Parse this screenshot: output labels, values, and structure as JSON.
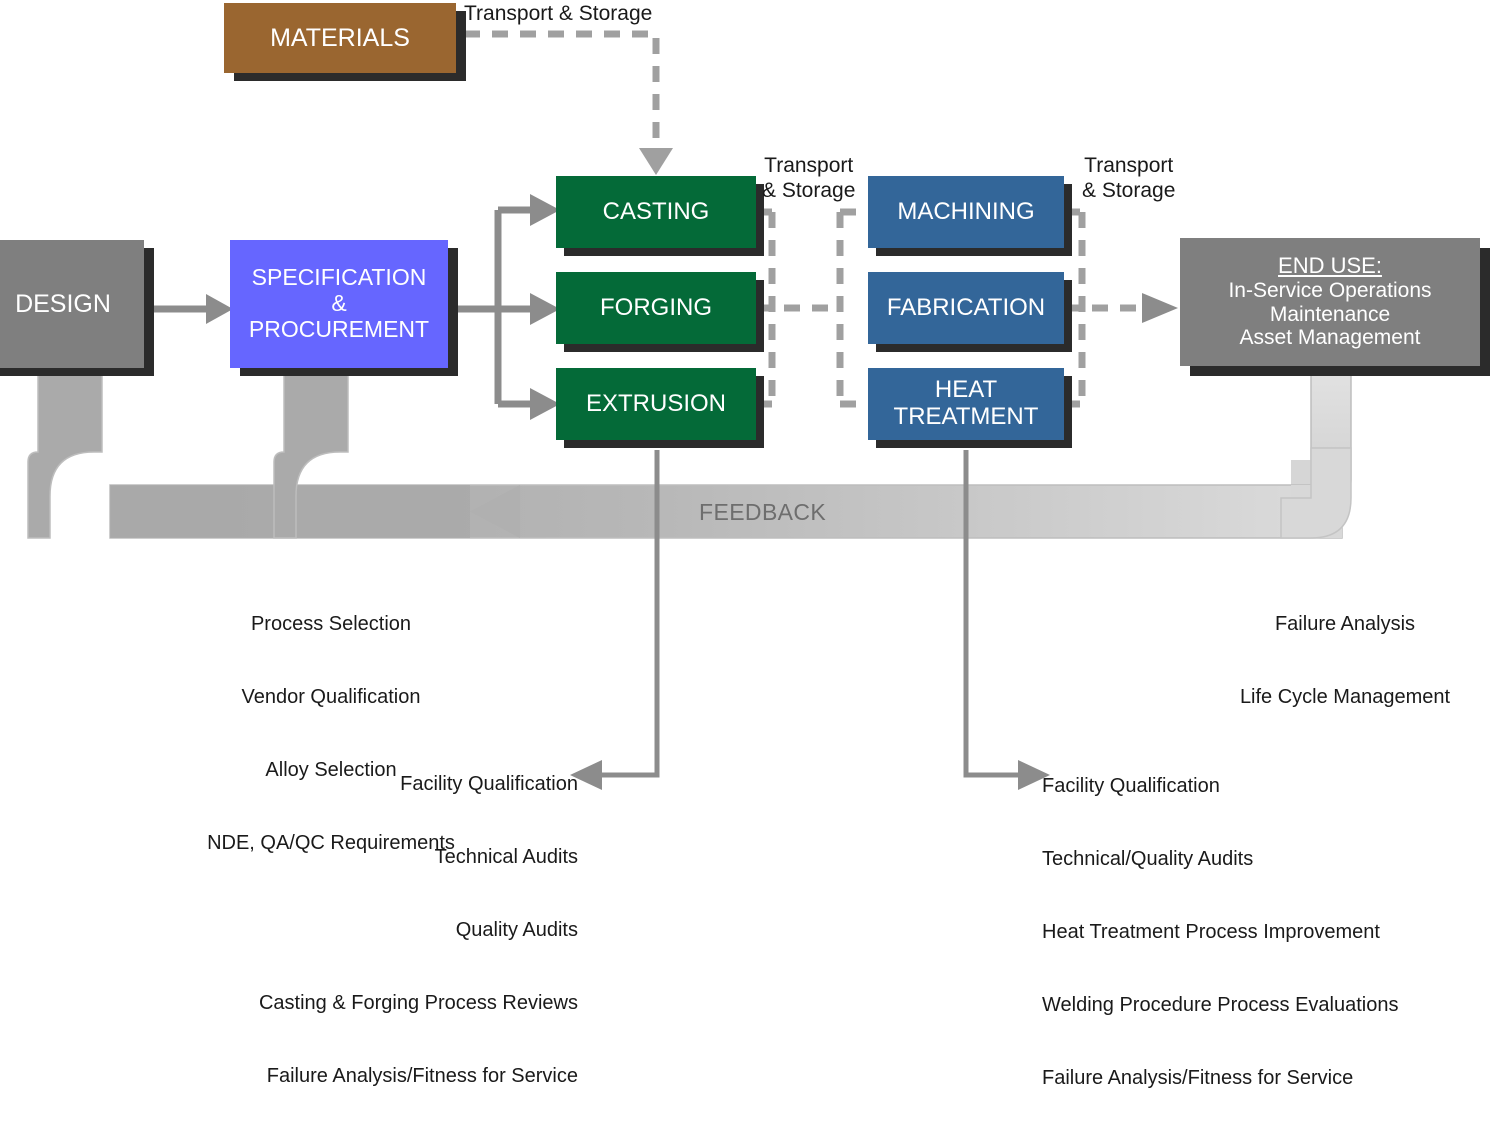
{
  "diagram": {
    "title": "Materials Lifecycle Process Flow",
    "palette": {
      "gray_box": "#7f7f7f",
      "purple_box": "#6666ff",
      "brown_box": "#9a6630",
      "green_box": "#046a38",
      "blue_box": "#336699",
      "shadow": "#2b2b2b",
      "connector_gray": "#8c8c8c",
      "feedback_band_light": "#d4d4d4",
      "feedback_band_dark": "#a8a8a8",
      "text_dark": "#1a1a1a",
      "text_light": "#ffffff"
    },
    "nodes": [
      {
        "id": "design",
        "label": "DESIGN",
        "kind": "gray"
      },
      {
        "id": "specification",
        "label": "SPECIFICATION\n&\nPROCUREMENT",
        "kind": "purple"
      },
      {
        "id": "materials",
        "label": "MATERIALS",
        "kind": "brown"
      },
      {
        "id": "casting",
        "label": "CASTING",
        "kind": "green"
      },
      {
        "id": "forging",
        "label": "FORGING",
        "kind": "green"
      },
      {
        "id": "extrusion",
        "label": "EXTRUSION",
        "kind": "green"
      },
      {
        "id": "machining",
        "label": "MACHINING",
        "kind": "blue"
      },
      {
        "id": "fabrication",
        "label": "FABRICATION",
        "kind": "blue"
      },
      {
        "id": "heat_treatment",
        "label": "HEAT\nTREATMENT",
        "kind": "blue"
      },
      {
        "id": "end_use",
        "label": "END USE:",
        "kind": "gray",
        "sublines": [
          "In-Service Operations",
          "Maintenance",
          "Asset Management"
        ]
      }
    ],
    "edge_labels": {
      "materials_transport": "Transport & Storage",
      "casting_transport": "Transport\n& Storage",
      "machining_transport": "Transport\n& Storage"
    },
    "feedback_label": "FEEDBACK",
    "annotations": {
      "specification_notes": [
        "Process Selection",
        "Vendor Qualification",
        "Alloy Selection",
        "NDE, QA/QC Requirements"
      ],
      "end_use_notes": [
        "Failure Analysis",
        "Life Cycle Management"
      ],
      "casting_notes": [
        "Facility Qualification",
        "Technical Audits",
        "Quality Audits",
        "Casting & Forging Process Reviews",
        "Failure Analysis/Fitness for Service"
      ],
      "heat_treatment_notes": [
        "Facility Qualification",
        "Technical/Quality Audits",
        "Heat Treatment Process Improvement",
        "Welding Procedure Process Evaluations",
        "Failure Analysis/Fitness for Service"
      ]
    }
  }
}
